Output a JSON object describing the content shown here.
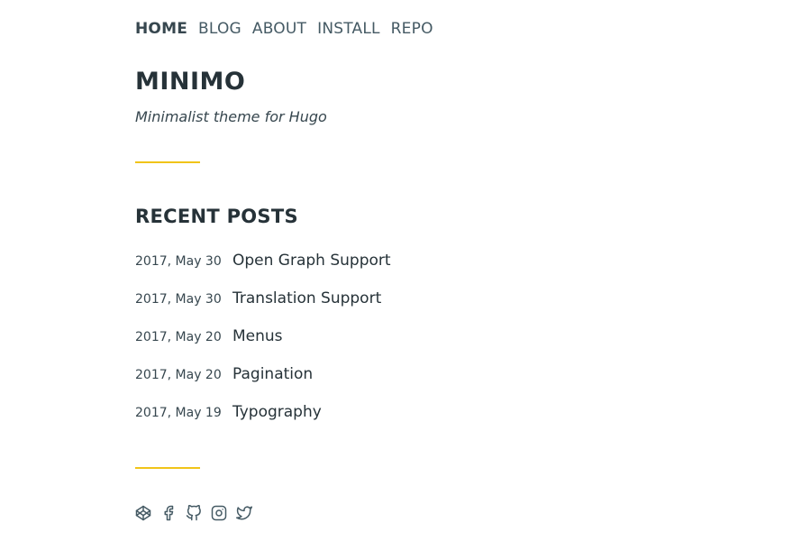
{
  "nav": {
    "items": [
      {
        "label": "HOME",
        "active": true
      },
      {
        "label": "BLOG",
        "active": false
      },
      {
        "label": "ABOUT",
        "active": false
      },
      {
        "label": "INSTALL",
        "active": false
      },
      {
        "label": "REPO",
        "active": false
      }
    ]
  },
  "site": {
    "title": "MINIMO",
    "tagline": "Minimalist theme for Hugo"
  },
  "recent_posts": {
    "heading": "RECENT POSTS",
    "items": [
      {
        "date": "2017, May 30",
        "title": "Open Graph Support"
      },
      {
        "date": "2017, May 30",
        "title": "Translation Support"
      },
      {
        "date": "2017, May 20",
        "title": "Menus"
      },
      {
        "date": "2017, May 20",
        "title": "Pagination"
      },
      {
        "date": "2017, May 19",
        "title": "Typography"
      }
    ]
  },
  "social": {
    "icons": [
      "codepen-icon",
      "facebook-icon",
      "github-icon",
      "instagram-icon",
      "twitter-icon"
    ]
  },
  "colors": {
    "accent": "#f0c419",
    "text": "#263238",
    "muted": "#455a64"
  }
}
